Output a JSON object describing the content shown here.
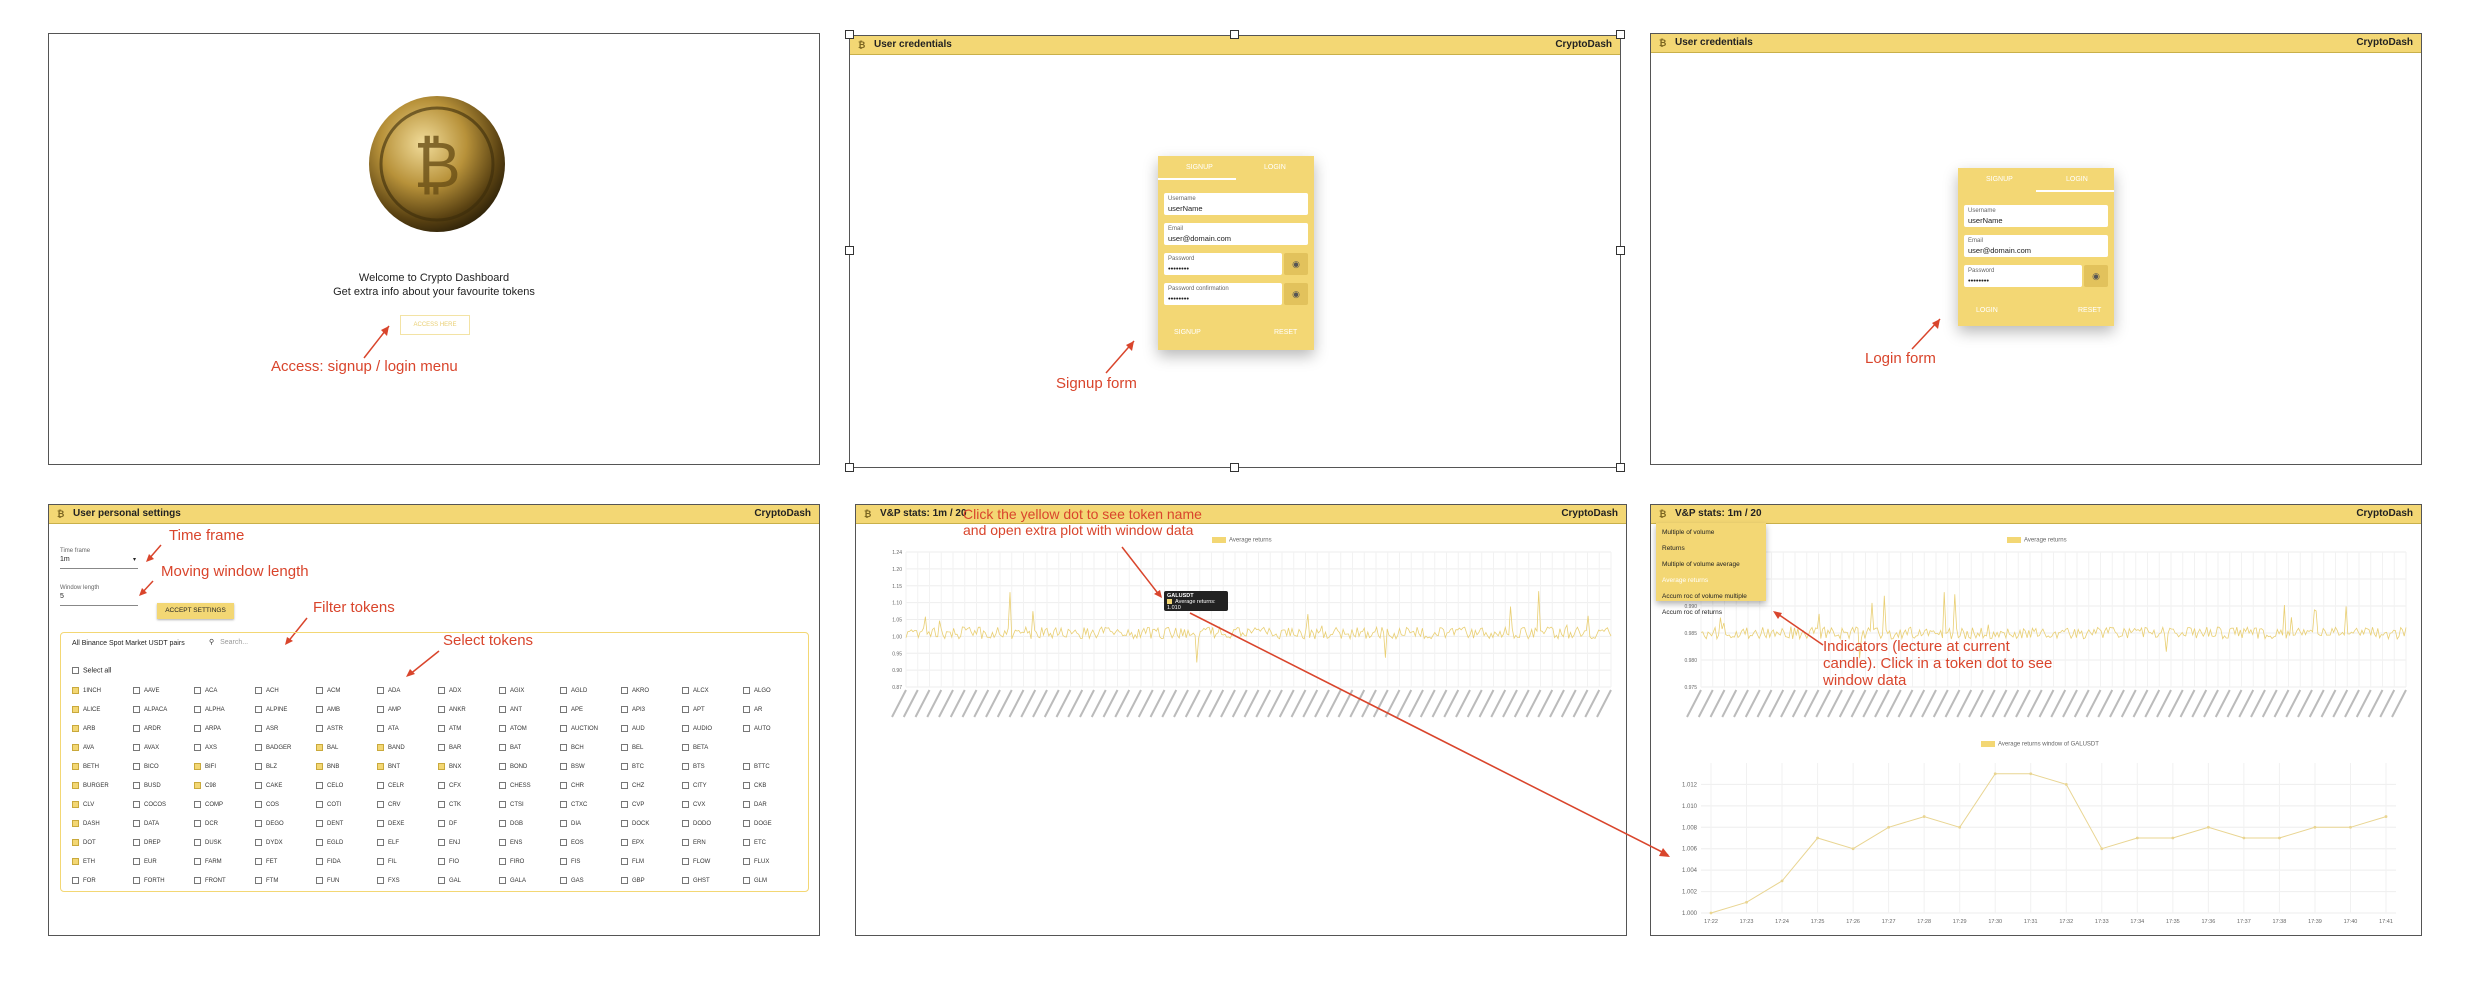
{
  "colors": {
    "accent": "#f3d774",
    "annotation": "#d9452c",
    "panel_border": "#555555"
  },
  "panel1": {
    "image_alt": "bitcoin-coin-image",
    "welcome_line1": "Welcome to Crypto Dashboard",
    "welcome_line2": "Get extra info about your favourite tokens",
    "access_button": "ACCESS HERE",
    "annotation": "Access: signup / login menu"
  },
  "panel2": {
    "title": "User credentials",
    "brand": "CryptoDash",
    "tabs": [
      "SIGNUP",
      "LOGIN"
    ],
    "fields": [
      {
        "label": "Username",
        "value": "userName"
      },
      {
        "label": "Email",
        "value": "user@domain.com"
      },
      {
        "label": "Password",
        "value": "••••••••"
      },
      {
        "label": "Password confirmation",
        "value": "••••••••"
      }
    ],
    "buttons": [
      "SIGNUP",
      "RESET"
    ],
    "annotation": "Signup form"
  },
  "panel3": {
    "title": "User credentials",
    "brand": "CryptoDash",
    "tabs": [
      "SIGNUP",
      "LOGIN"
    ],
    "fields": [
      {
        "label": "Username",
        "value": "userName"
      },
      {
        "label": "Email",
        "value": "user@domain.com"
      },
      {
        "label": "Password",
        "value": "••••••••"
      }
    ],
    "buttons": [
      "LOGIN",
      "RESET"
    ],
    "annotation": "Login form"
  },
  "panel4": {
    "title": "User personal settings",
    "brand": "CryptoDash",
    "time_frame_label": "Time frame",
    "time_frame_value": "1m",
    "window_length_label": "Window length",
    "window_length_value": "5",
    "accept_button": "ACCEPT SETTINGS",
    "pairs_label": "All Binance Spot Market USDT pairs",
    "search_placeholder": "Search...",
    "select_all": "Select all",
    "annotations": {
      "time_frame": "Time frame",
      "window_length": "Moving window length",
      "filter": "Filter tokens",
      "select": "Select tokens"
    },
    "tokens": [
      [
        "1INCH",
        "AAVE",
        "ACA",
        "ACH",
        "ACM",
        "ADA",
        "ADX",
        "AGIX",
        "AGLD",
        "AKRO",
        "ALCX",
        "ALGO"
      ],
      [
        "ALICE",
        "ALPACA",
        "ALPHA",
        "ALPINE",
        "AMB",
        "AMP",
        "ANKR",
        "ANT",
        "APE",
        "API3",
        "APT",
        "AR"
      ],
      [
        "ARB",
        "ARDR",
        "ARPA",
        "ASR",
        "ASTR",
        "ATA",
        "ATM",
        "ATOM",
        "AUCTION",
        "AUD",
        "AUDIO",
        "AUTO"
      ],
      [
        "AVA",
        "AVAX",
        "AXS",
        "BADGER",
        "BAL",
        "BAND",
        "BAR",
        "BAT",
        "BCH",
        "BEL",
        "BETA"
      ],
      [
        "BETH",
        "BICO",
        "BIFI",
        "BLZ",
        "BNB",
        "BNT",
        "BNX",
        "BOND",
        "BSW",
        "BTC",
        "BTS",
        "BTTC"
      ],
      [
        "BURGER",
        "BUSD",
        "C98",
        "CAKE",
        "CELO",
        "CELR",
        "CFX",
        "CHESS",
        "CHR",
        "CHZ",
        "CITY",
        "CKB"
      ],
      [
        "CLV",
        "COCOS",
        "COMP",
        "COS",
        "COTI",
        "CRV",
        "CTK",
        "CTSI",
        "CTXC",
        "CVP",
        "CVX",
        "DAR"
      ],
      [
        "DASH",
        "DATA",
        "DCR",
        "DEGO",
        "DENT",
        "DEXE",
        "DF",
        "DGB",
        "DIA",
        "DOCK",
        "DODO",
        "DOGE"
      ],
      [
        "DOT",
        "DREP",
        "DUSK",
        "DYDX",
        "EGLD",
        "ELF",
        "ENJ",
        "ENS",
        "EOS",
        "EPX",
        "ERN",
        "ETC"
      ],
      [
        "ETH",
        "EUR",
        "FARM",
        "FET",
        "FIDA",
        "FIL",
        "FIO",
        "FIRO",
        "FIS",
        "FLM",
        "FLOW",
        "FLUX"
      ],
      [
        "FOR",
        "FORTH",
        "FRONT",
        "FTM",
        "FUN",
        "FXS",
        "GAL",
        "GALA",
        "GAS",
        "GBP",
        "GHST",
        "GLM"
      ]
    ],
    "checked": [
      [
        0,
        0
      ],
      [
        1,
        0
      ],
      [
        2,
        0
      ],
      [
        3,
        0
      ],
      [
        4,
        0
      ],
      [
        4,
        2
      ],
      [
        4,
        4
      ],
      [
        4,
        6
      ],
      [
        5,
        0
      ],
      [
        6,
        0
      ],
      [
        7,
        0
      ],
      [
        8,
        0
      ],
      [
        9,
        0
      ],
      [
        3,
        4
      ],
      [
        3,
        5
      ],
      [
        5,
        2
      ],
      [
        4,
        5
      ]
    ]
  },
  "panel5": {
    "title": "V&P stats: 1m / 20",
    "brand": "CryptoDash",
    "legend": "Average returns",
    "tooltip_title": "GALUSDT",
    "tooltip_value": "Average returns: 1.010",
    "annotation_line1": "Click the yellow dot to see token name",
    "annotation_line2": "and open extra plot with window data",
    "y_ticks": [
      "1.24",
      "1.20",
      "1.15",
      "1.10",
      "1.05",
      "1.00",
      "0.95",
      "0.90",
      "0.87"
    ]
  },
  "panel6": {
    "title": "V&P stats: 1m / 20",
    "brand": "CryptoDash",
    "legend": "Average returns",
    "menu": [
      "Multiple of volume",
      "Returns",
      "Multiple of volume average",
      "Average returns",
      "Accum roc of volume multiple",
      "Accum roc of returns"
    ],
    "menu_selected": 3,
    "y_ticks_top": [
      "1.000",
      "0.995",
      "0.990",
      "0.985",
      "0.980",
      "0.975"
    ],
    "annotation_line1": "Indicators (lecture at current",
    "annotation_line2": "candle). Click in a token dot to see",
    "annotation_line3": "window data",
    "chart_data": {
      "type": "line",
      "title": "Average returns window of GALUSDT",
      "x": [
        "17:22",
        "17:23",
        "17:24",
        "17:25",
        "17:26",
        "17:27",
        "17:28",
        "17:29",
        "17:30",
        "17:31",
        "17:32",
        "17:33",
        "17:34",
        "17:35",
        "17:36",
        "17:37",
        "17:38",
        "17:39",
        "17:40",
        "17:41"
      ],
      "series": [
        {
          "name": "Average returns window of GALUSDT",
          "values": [
            1.0,
            1.001,
            1.003,
            1.007,
            1.006,
            1.008,
            1.009,
            1.008,
            1.013,
            1.013,
            1.012,
            1.006,
            1.007,
            1.007,
            1.008,
            1.007,
            1.007,
            1.008,
            1.008,
            1.009
          ]
        }
      ],
      "y_ticks": [
        "1.012",
        "1.010",
        "1.008",
        "1.006",
        "1.004",
        "1.002",
        "1.000"
      ],
      "ylim": [
        1.0,
        1.014
      ]
    }
  }
}
